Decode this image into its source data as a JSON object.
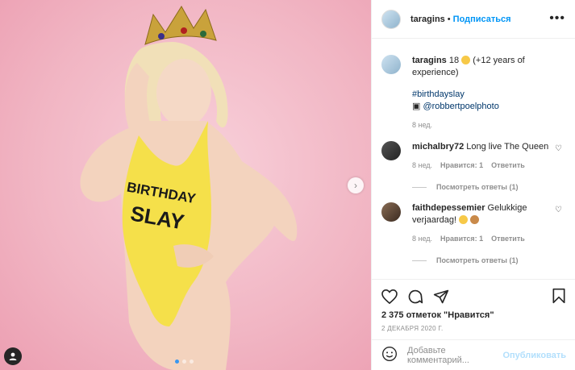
{
  "post": {
    "author": "taragins",
    "follow_label": "Подписаться",
    "separator": "•",
    "more_label": "•••",
    "caption": {
      "username": "taragins",
      "text": "18",
      "text_after_emoji": "(+12 years of experience)",
      "hashtag": "#birthdayslay",
      "photo_credit": "@robbertpoelphoto",
      "time": "8 нед."
    },
    "comments": [
      {
        "username": "michalbry72",
        "text": "Long live The Queen",
        "time": "8 нед.",
        "likes": "Нравится: 1",
        "reply_label": "Ответить",
        "replies_label": "Посмотреть ответы (1)"
      },
      {
        "username": "faithdepessemier",
        "text": "Gelukkige verjaardag!",
        "time": "8 нед.",
        "likes": "Нравится: 1",
        "reply_label": "Ответить",
        "replies_label": "Посмотреть ответы (1)"
      }
    ],
    "likes_count": "2 375 отметок \"Нравится\"",
    "date": "2 ДЕКАБРЯ 2020 Г.",
    "comment_placeholder": "Добавьте комментарий...",
    "publish_label": "Опубликовать",
    "swimsuit_text_line1": "BIRTHDAY",
    "swimsuit_text_line2": "SLAY",
    "carousel": {
      "current": 1,
      "total": 3
    }
  },
  "colors": {
    "accent": "#0095f6",
    "background_photo": "#f4bcc8",
    "swimsuit": "#f5e04a",
    "muted": "#8e8e8e"
  },
  "icons": [
    "heart-icon",
    "comment-icon",
    "share-icon",
    "bookmark-icon",
    "smiley-icon",
    "more-icon",
    "chevron-right-icon",
    "user-tag-icon"
  ]
}
